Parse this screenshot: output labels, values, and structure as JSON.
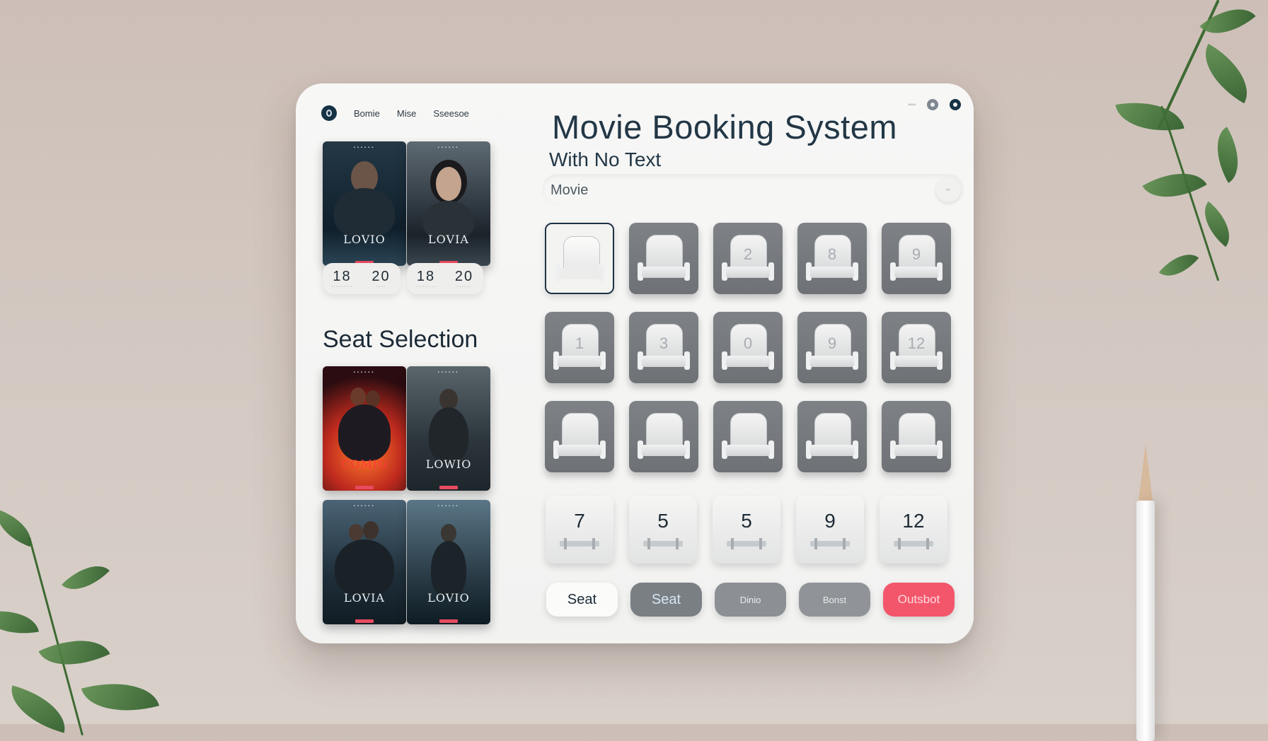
{
  "nav": {
    "links": [
      "Bomie",
      "Mise",
      "Sseesoe"
    ]
  },
  "header": {
    "title": "Movie Booking System",
    "subtitle": "With No Text"
  },
  "search": {
    "placeholder": "Movie",
    "button_label": "◦◦"
  },
  "posters": [
    {
      "title": "LOVIO",
      "colors": [
        "#0f1f2b",
        "#3c5e72"
      ]
    },
    {
      "title": "LOVIA",
      "colors": [
        "#1b232a",
        "#6a7680"
      ]
    },
    {
      "title": "COMIG",
      "colors": [
        "#2b0c10",
        "#e44a26"
      ]
    },
    {
      "title": "LOWIO",
      "colors": [
        "#1d262b",
        "#5a666c"
      ]
    },
    {
      "title": "LOVIA",
      "colors": [
        "#111c24",
        "#4b6475"
      ]
    },
    {
      "title": "LOVIO",
      "colors": [
        "#0e1c24",
        "#5a7686"
      ]
    }
  ],
  "stats": {
    "left": {
      "a": "18",
      "b": "20"
    },
    "right": {
      "a": "18",
      "b": "20"
    }
  },
  "seat_section": {
    "heading": "Seat Selection"
  },
  "seats": [
    {
      "label": "",
      "selected": true
    },
    {
      "label": ""
    },
    {
      "label": "2"
    },
    {
      "label": "8"
    },
    {
      "label": "9"
    },
    {
      "label": "1"
    },
    {
      "label": "3"
    },
    {
      "label": "0"
    },
    {
      "label": "9"
    },
    {
      "label": "12"
    },
    {
      "label": ""
    },
    {
      "label": ""
    },
    {
      "label": ""
    },
    {
      "label": ""
    },
    {
      "label": ""
    }
  ],
  "number_tiles": [
    "7",
    "5",
    "5",
    "9",
    "12"
  ],
  "actions": {
    "seat_primary": "Seat",
    "seat_secondary": "Seat",
    "option_one": "Dinio",
    "option_two": "Bonst",
    "checkout": "Outsbot"
  },
  "colors": {
    "navy": "#163245",
    "accent_red": "#f3566b",
    "seat_gray": "#7a7f84"
  }
}
